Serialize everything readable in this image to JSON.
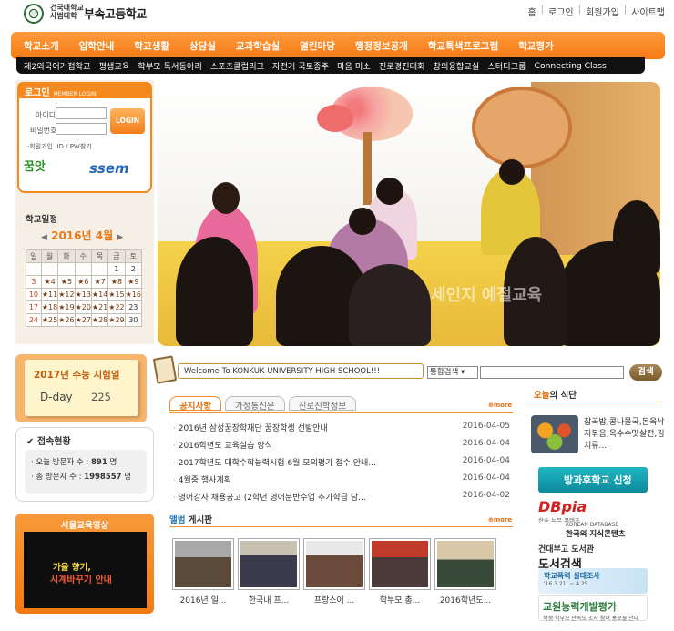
{
  "header": {
    "logo_small_1": "건국대학교",
    "logo_small_2": "사범대학",
    "logo_main": "부속고등학교",
    "links": [
      "홈",
      "로그인",
      "회원가입",
      "사이트맵"
    ]
  },
  "gnb": [
    "학교소개",
    "입학안내",
    "학교생활",
    "상담실",
    "교과학습실",
    "열린마당",
    "행정정보공개",
    "학교특색프로그램",
    "학교평가"
  ],
  "subnav": [
    "제2외국어거점학교",
    "평생교육",
    "학부모 독서동아리",
    "스포츠클럽리그",
    "자전거 국토종주",
    "마음 미소",
    "진로경진대회",
    "창의융합교실",
    "스터디그룹",
    "Connecting Class"
  ],
  "login": {
    "title": "로그인",
    "subtitle": "MEMBER LOGIN",
    "id_label": "아이디",
    "pw_label": "비밀번호",
    "button": "LOGIN",
    "links": "·회원가입  ·ID / PW찾기"
  },
  "banners_left": {
    "a": "꿈앗",
    "b": "ssem"
  },
  "calendar": {
    "title": "학교일정",
    "prev": "◀",
    "month": "2016년 4월",
    "next": "▶",
    "weekdays": [
      "일",
      "월",
      "화",
      "수",
      "목",
      "금",
      "토"
    ],
    "rows": [
      [
        "",
        "",
        "",
        "",
        "",
        "1",
        "2"
      ],
      [
        "3",
        "★4",
        "★5",
        "★6",
        "★7",
        "★8",
        "★9"
      ],
      [
        "10",
        "★11",
        "★12",
        "★13",
        "★14",
        "★15",
        "★16"
      ],
      [
        "17",
        "★18",
        "★19",
        "★20",
        "★21",
        "★22",
        "23"
      ],
      [
        "24",
        "★25",
        "★26",
        "★27",
        "★28",
        "★29",
        "30"
      ]
    ]
  },
  "hero": {
    "watermark": "세인지 예절교육"
  },
  "search": {
    "welcome": "Welcome To KONKUK UNIVERSITY HIGH SCHOOL!!!",
    "select": "통합검색",
    "button": "검색"
  },
  "suneung": {
    "title": "2017년 수능 시험일",
    "dday_label": "D-day",
    "dday_value": "225"
  },
  "visitors": {
    "title": "접속현황",
    "today_label": "· 오늘 방문자 수 :",
    "today_value": "891",
    "total_label": "· 총 방문자 수 :",
    "total_value": "1998557",
    "unit": "명"
  },
  "seoul": {
    "title": "서울교육영상",
    "line1": "가을 향기,",
    "line2": "시계바꾸기 안내"
  },
  "notice": {
    "tabs": [
      "공지사항",
      "가정통신문",
      "진로진학정보"
    ],
    "more": "more",
    "items": [
      {
        "title": "2016년 삼성꿈장학재단 꿈장학생 선발안내",
        "date": "2016-04-05"
      },
      {
        "title": "2016학년도 교육실습 양식",
        "date": "2016-04-04"
      },
      {
        "title": "2017학년도 대학수학능력시험 6월 모의평가 접수 안내...",
        "date": "2016-04-04"
      },
      {
        "title": "4월중 행사계획",
        "date": "2016-04-04"
      },
      {
        "title": "영어강사 채용공고 (2학년 영어분반수업 추가학급 담...",
        "date": "2016-04-02"
      }
    ]
  },
  "gallery": {
    "title_a": "앨범",
    "title_b": " 게시판",
    "more": "more",
    "items": [
      "2016년 일...",
      "한국내 프...",
      "프랑스어 ...",
      "학부모 총...",
      "2016학년도..."
    ]
  },
  "meal": {
    "title_a": "오늘",
    "title_b": "의 식단",
    "text": "잡곡밥,콩나물국,돈육낙지볶음,옥수수맛살전,김치류..."
  },
  "banners_right": {
    "b1": "방과후학교 신청",
    "b2a": "DBpia",
    "b2b": "학술 논문 콘텐츠",
    "b3a": "KOREAN DATABASE",
    "b3b": "한국의 지식콘텐츠",
    "b4a": "건대부고 도서관",
    "b4b": "도서검색",
    "b5a": "학교폭력 실태조사",
    "b5b": "'16.3.21. ~ 4.25",
    "b6a": "교원능력개발평가",
    "b6b": "학생·학부모 만족도 조사 참여 홍보물 안내"
  },
  "colors": {
    "accent": "#f5891d",
    "nav_dark": "#111111",
    "link_blue": "#2a7ab5"
  }
}
